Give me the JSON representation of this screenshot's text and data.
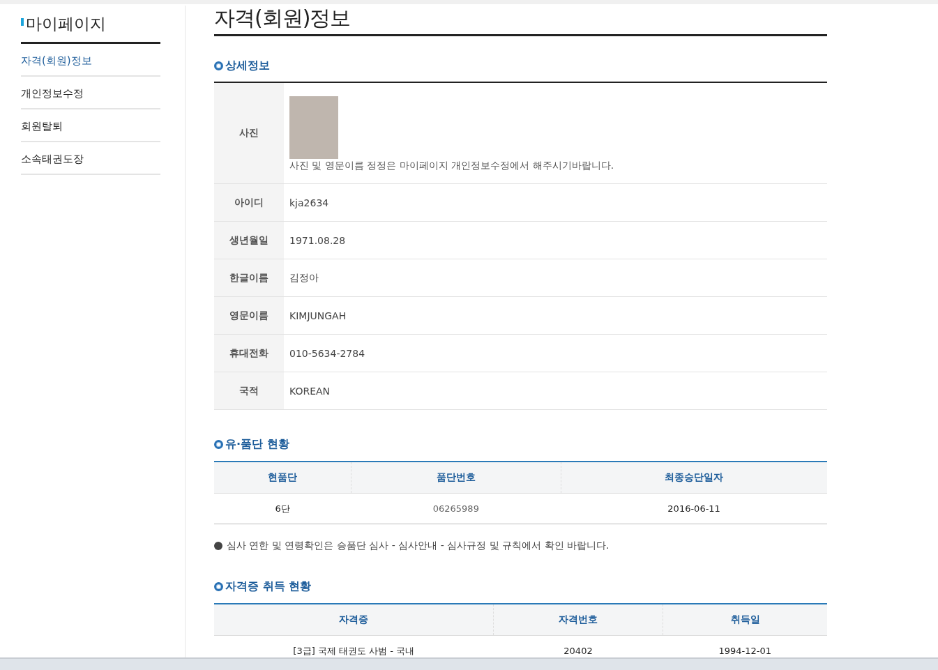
{
  "sidebar": {
    "title": "마이페이지",
    "items": [
      {
        "label": "자격(회원)정보",
        "selected": true
      },
      {
        "label": "개인정보수정",
        "selected": false
      },
      {
        "label": "회원탈퇴",
        "selected": false
      },
      {
        "label": "소속태권도장",
        "selected": false
      }
    ]
  },
  "page_title": "자격(회원)정보",
  "detail": {
    "heading": "상세정보",
    "photo_label": "사진",
    "photo_note": "사진 및 영문이름 정정은 마이페이지 개인정보수정에서 해주시기바랍니다.",
    "rows": [
      {
        "label": "아이디",
        "value": "kja2634"
      },
      {
        "label": "생년월일",
        "value": "1971.08.28"
      },
      {
        "label": "한글이름",
        "value": "김정아"
      },
      {
        "label": "영문이름",
        "value": "KIMJUNGAH"
      },
      {
        "label": "휴대전화",
        "value": "010-5634-2784"
      },
      {
        "label": "국적",
        "value": "KOREAN"
      }
    ]
  },
  "dan": {
    "heading": "유·품단 현황",
    "columns": [
      "현품단",
      "품단번호",
      "최종승단일자"
    ],
    "rows": [
      [
        "6단",
        "06265989",
        "2016-06-11"
      ]
    ],
    "note": "심사 연한 및 연령확인은 승품단 심사 - 심사안내 - 심사규정 및 규칙에서 확인 바랍니다."
  },
  "cert": {
    "heading": "자격증 취득 현황",
    "columns": [
      "자격증",
      "자격번호",
      "취득일"
    ],
    "rows": [
      [
        "[3급] 국제 태권도 사범 - 국내",
        "20402",
        "1994-12-01"
      ]
    ]
  }
}
